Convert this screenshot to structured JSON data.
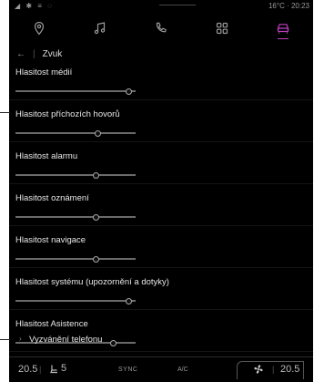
{
  "status_bar": {
    "left_icons": "◢ ✱ ≡ ◌",
    "right": "16°C · 20:23"
  },
  "nav": {
    "items": [
      {
        "icon": "location-pin-icon",
        "active": false
      },
      {
        "icon": "music-note-icon",
        "active": false
      },
      {
        "icon": "phone-icon",
        "active": false
      },
      {
        "icon": "apps-grid-icon",
        "active": false
      },
      {
        "icon": "car-icon",
        "active": true
      }
    ],
    "accent_color": "#c040c0"
  },
  "header": {
    "back_glyph": "←",
    "separator": "|",
    "title": "Zvuk"
  },
  "settings": [
    {
      "label": "Hlasitost médií",
      "level": 0.94
    },
    {
      "label": "Hlasitost příchozích hovorů",
      "level": 0.68
    },
    {
      "label": "Hlasitost alarmu",
      "level": 0.67
    },
    {
      "label": "Hlasitost oznámení",
      "level": 0.67
    },
    {
      "label": "Hlasitost navigace",
      "level": 0.67
    },
    {
      "label": "Hlasitost systému (upozornění a dotyky)",
      "level": 0.94
    },
    {
      "label": "Hlasitost Asistence",
      "level": 0.81
    }
  ],
  "ringtone": {
    "chevron": "›",
    "label": "Vyzvánění telefonu"
  },
  "bottom_bar": {
    "temp_left": "20.5",
    "separator": "|",
    "seat_level": "5",
    "sync_label": "SYNC",
    "ac_label": "A/C",
    "temp_right": "20.5"
  }
}
